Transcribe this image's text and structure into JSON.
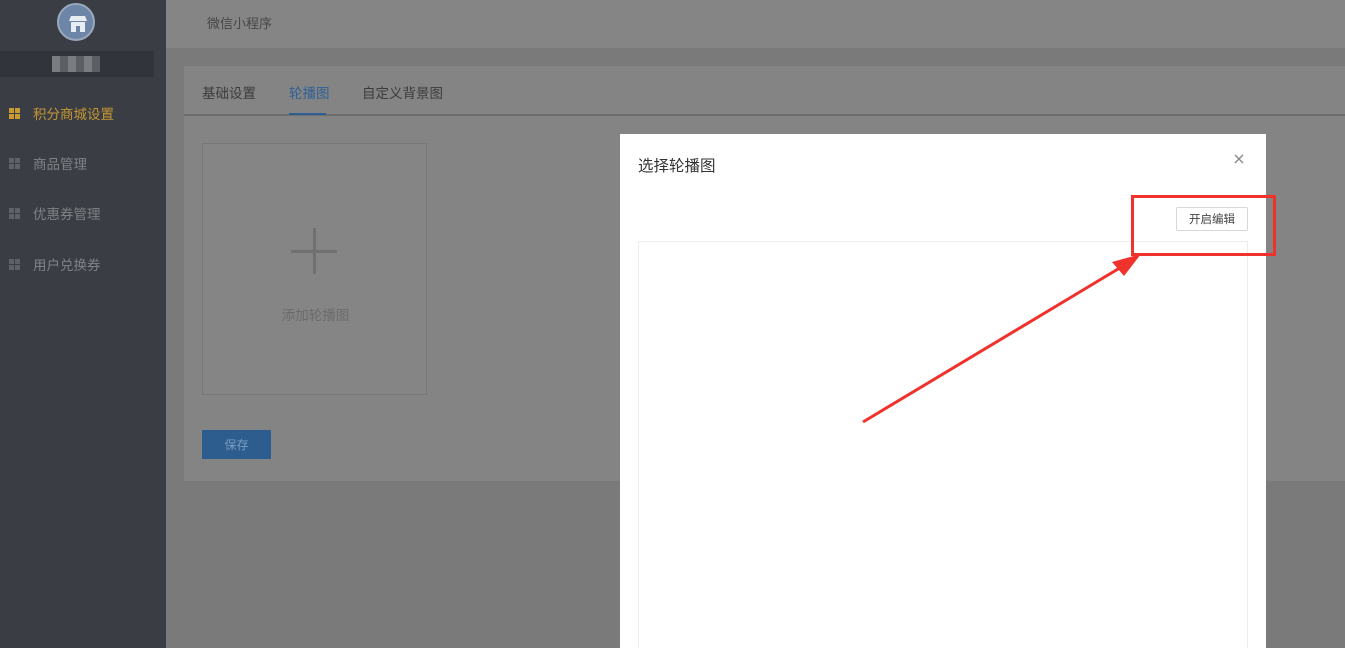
{
  "sidebar": {
    "username": "██████",
    "items": [
      {
        "label": "积分商城设置"
      },
      {
        "label": "商品管理"
      },
      {
        "label": "优惠券管理"
      },
      {
        "label": "用户兑换券"
      }
    ]
  },
  "header": {
    "title": "微信小程序"
  },
  "tabs": [
    {
      "label": "基础设置"
    },
    {
      "label": "轮播图"
    },
    {
      "label": "自定义背景图"
    }
  ],
  "carousel": {
    "add_label": "添加轮播图",
    "save_label": "保存"
  },
  "modal": {
    "title": "选择轮播图",
    "close_glyph": "×",
    "edit_label": "开启编辑"
  },
  "colors": {
    "accent": "#c59733",
    "annotation": "#f0322c",
    "primary": "#2d5c8f"
  }
}
